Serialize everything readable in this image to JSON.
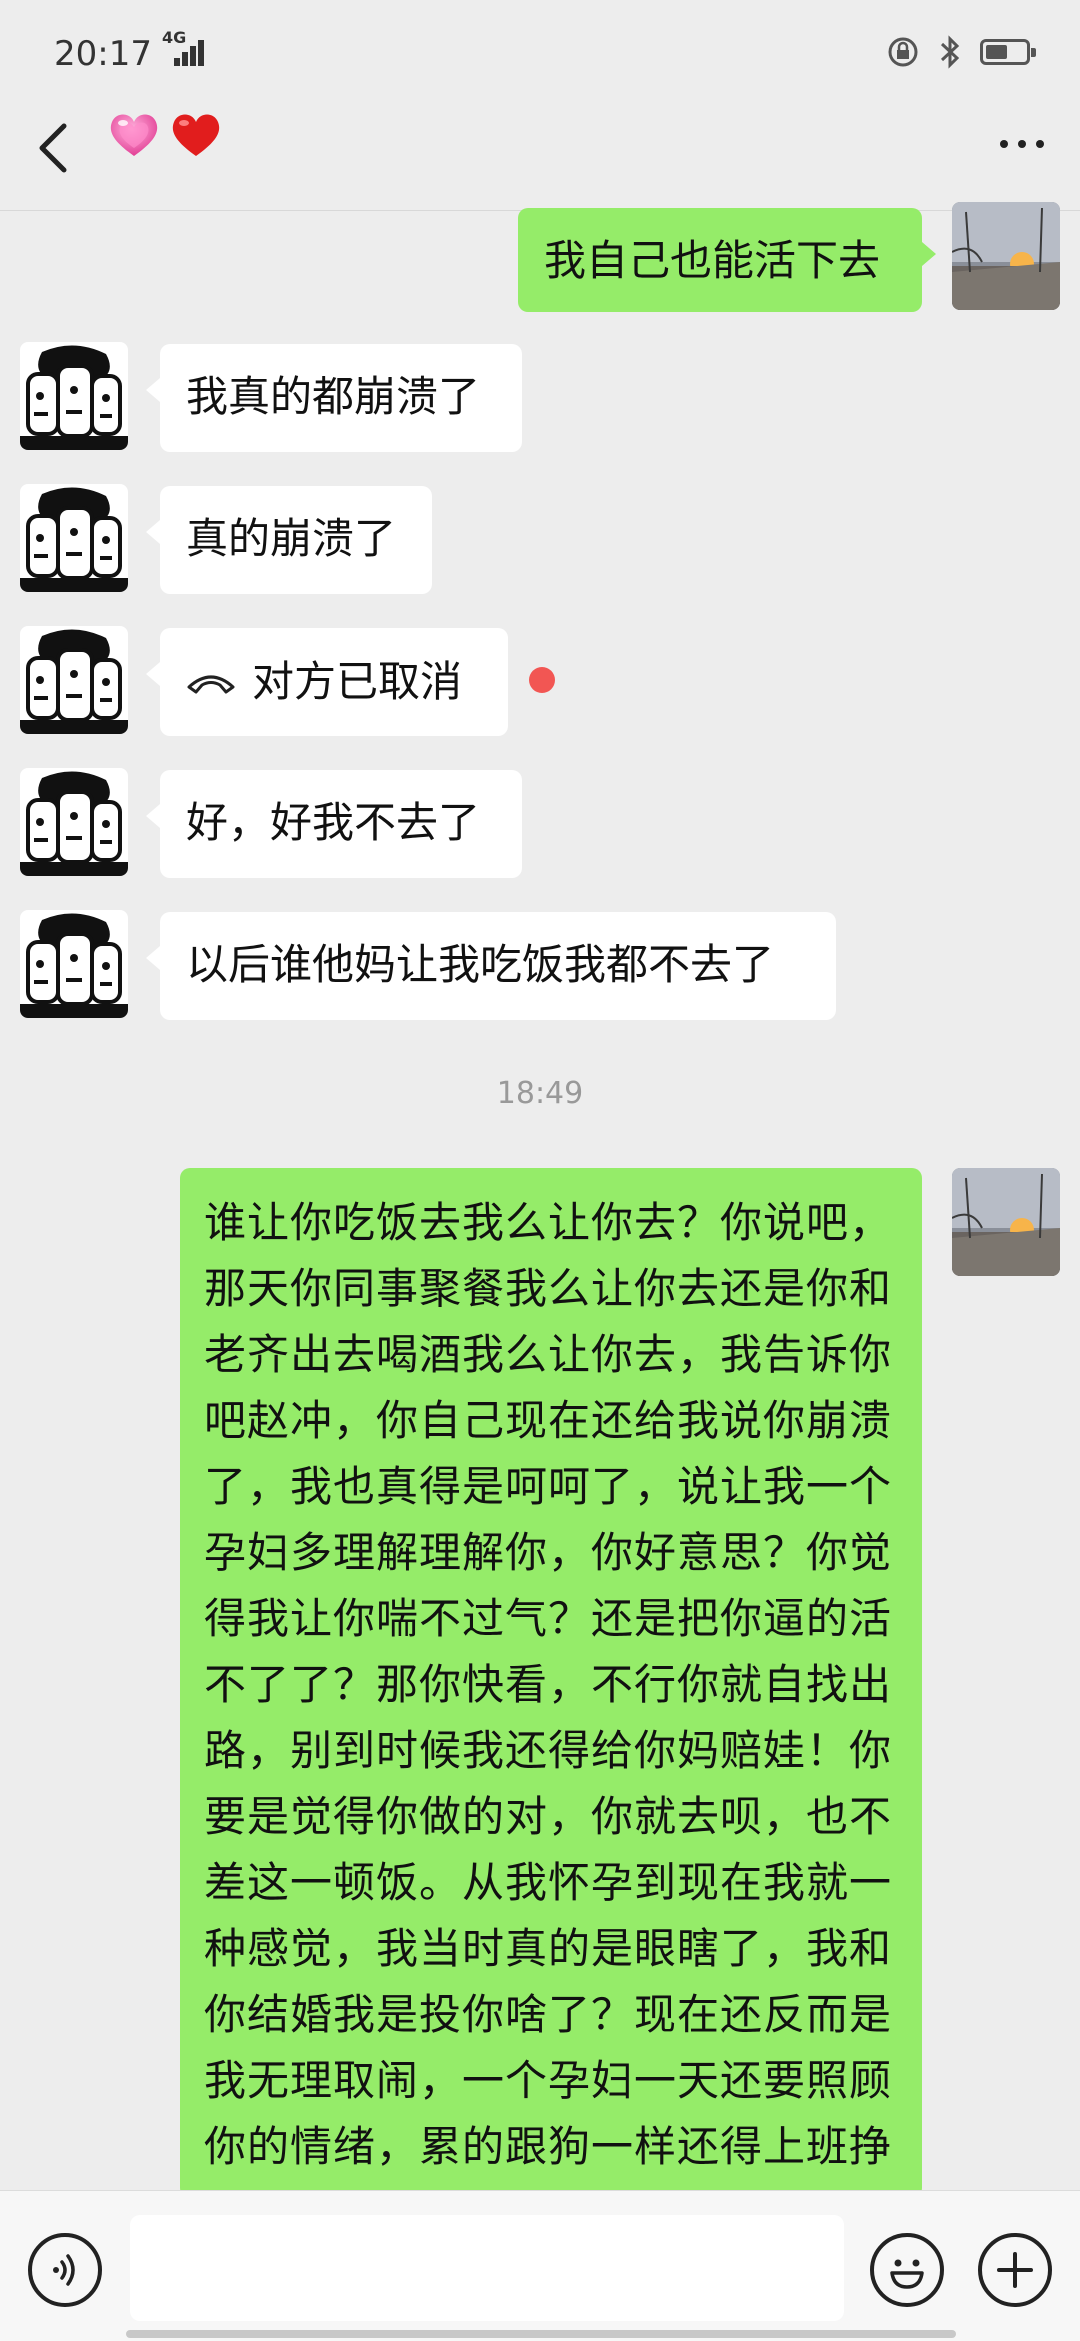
{
  "status": {
    "time": "20:17",
    "network": "4G"
  },
  "header": {
    "title_emojis": [
      "💗",
      "❤️"
    ]
  },
  "messages": [
    {
      "side": "out",
      "text": "我自己也能活下去"
    },
    {
      "side": "in",
      "text": "我真的都崩溃了"
    },
    {
      "side": "in",
      "text": "真的崩溃了"
    },
    {
      "side": "in",
      "text": "对方已取消",
      "type": "call",
      "icon": "hangup-phone-icon"
    },
    {
      "side": "in",
      "text": "好，好我不去了"
    },
    {
      "side": "in",
      "text": "以后谁他妈让我吃饭我都不去了"
    },
    {
      "side": "out",
      "text": "谁让你吃饭去我么让你去？你说吧，那天你同事聚餐我么让你去还是你和老齐出去喝酒我么让你去，我告诉你吧赵冲，你自己现在还给我说你崩溃了，我也真得是呵呵了，说让我一个孕妇多理解理解你，你好意思？你觉得我让你喘不过气？还是把你逼的活不了了？那你快看，不行你就自找出路，别到时候我还得给你妈赔娃！你要是觉得你做的对，你就去呗，也不差这一顿饭。从我怀孕到现在我就一种感觉，我当时真的是眼瞎了，我和你结婚我是投你啥了？现在还反而是我无理取闹，一个孕妇一天还要照顾你的情绪，累的跟狗一样还得上班挣"
    }
  ],
  "timestamp": "18:49",
  "colors": {
    "background": "#ededed",
    "outgoing_bubble": "#95ec69",
    "incoming_bubble": "#ffffff",
    "unread_dot": "#f25653"
  }
}
